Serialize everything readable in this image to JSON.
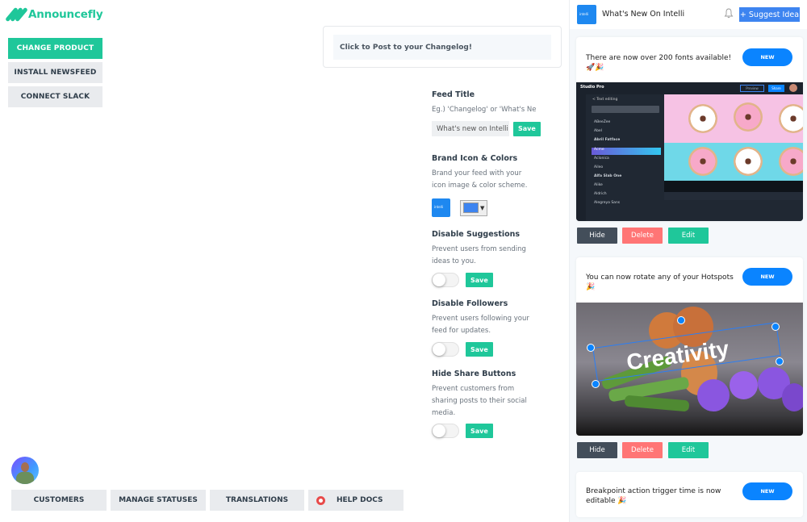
{
  "app": {
    "name": "Announcefly",
    "brand_color": "#1fc79a"
  },
  "left_nav": [
    {
      "label": "CHANGE PRODUCT",
      "active": true
    },
    {
      "label": "INSTALL NEWSFEED",
      "active": false
    },
    {
      "label": "CONNECT SLACK",
      "active": false
    }
  ],
  "post_box": {
    "label": "Click to Post to your Changelog!"
  },
  "settings": {
    "feed_title": {
      "title": "Feed Title",
      "desc": "Eg.) 'Changelog' or 'What's New'",
      "value": "What's new on Intelli",
      "save_label": "Save"
    },
    "brand": {
      "title": "Brand Icon & Colors",
      "desc": "Brand your feed with your icon image & color scheme.",
      "color": "#3d84f0",
      "icon_caption": "intelli"
    },
    "disable_suggestions": {
      "title": "Disable Suggestions",
      "desc": "Prevent users from sending ideas to you.",
      "enabled": false,
      "save_label": "Save"
    },
    "disable_followers": {
      "title": "Disable Followers",
      "desc": "Prevent users following your feed for updates.",
      "enabled": false,
      "save_label": "Save"
    },
    "hide_share": {
      "title": "Hide Share Buttons",
      "desc": "Prevent customers from sharing posts to their social media.",
      "enabled": false,
      "save_label": "Save"
    }
  },
  "bottom_nav": [
    {
      "label": "CUSTOMERS",
      "icon": ""
    },
    {
      "label": "MANAGE STATUSES",
      "icon": ""
    },
    {
      "label": "TRANSLATIONS",
      "icon": ""
    },
    {
      "label": "HELP DOCS",
      "icon": "lifebuoy-icon"
    }
  ],
  "feed_preview": {
    "title": "What's New On Intelli",
    "suggest_label": "+ Suggest Idea",
    "icon_caption": "intelli",
    "posts": [
      {
        "text": "There are now over 200 fonts available! 🚀🎉",
        "badge": "NEW",
        "image": "studio-pro-font-picker",
        "studio_title": "Studio Pro",
        "studio_share": "Share",
        "studio_preview": "Preview",
        "studio_fonts_header": "< Text editing",
        "studio_fonts": [
          "ABeeZee",
          "Abel",
          "Abril Fatface",
          "Acme",
          "Aclonica",
          "Aileo",
          "Alfa Slab One",
          "Alike",
          "Aldrich",
          "Alegreya Sans"
        ]
      },
      {
        "text": "You can now rotate any of your Hotspots 🎉",
        "badge": "NEW",
        "image": "food-photo-rotated-text",
        "overlay_text": "Creativity"
      },
      {
        "text": "Breakpoint action trigger time is now editable 🎉",
        "badge": "NEW"
      }
    ],
    "actions": {
      "hide": "Hide",
      "delete": "Delete",
      "edit": "Edit"
    }
  }
}
